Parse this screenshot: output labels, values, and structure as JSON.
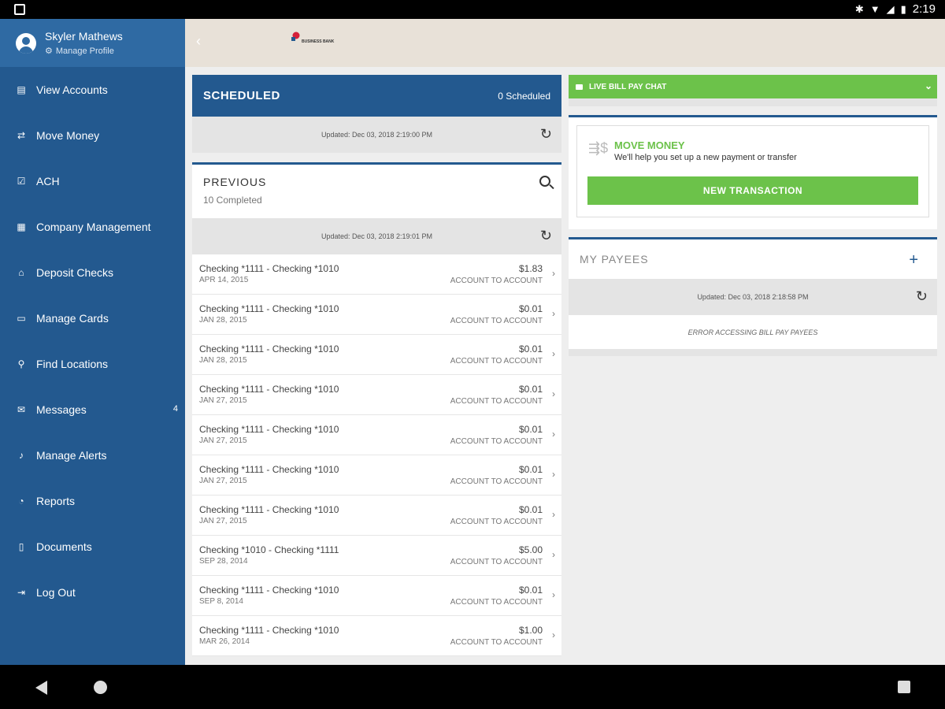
{
  "status_bar": {
    "time": "2:19"
  },
  "profile": {
    "name": "Skyler Mathews",
    "manage_label": "Manage Profile"
  },
  "sidebar": {
    "items": [
      {
        "label": "View Accounts",
        "icon": "accounts-icon",
        "glyph": "▤"
      },
      {
        "label": "Move Money",
        "icon": "transfer-icon",
        "glyph": "⇄"
      },
      {
        "label": "ACH",
        "icon": "check-icon",
        "glyph": "☑"
      },
      {
        "label": "Company Management",
        "icon": "building-icon",
        "glyph": "▦"
      },
      {
        "label": "Deposit Checks",
        "icon": "bank-icon",
        "glyph": "⌂"
      },
      {
        "label": "Manage Cards",
        "icon": "card-icon",
        "glyph": "▭"
      },
      {
        "label": "Find Locations",
        "icon": "location-pin-icon",
        "glyph": "⚲"
      },
      {
        "label": "Messages",
        "icon": "mail-icon",
        "glyph": "✉",
        "badge": "4"
      },
      {
        "label": "Manage Alerts",
        "icon": "bell-icon",
        "glyph": "♪"
      },
      {
        "label": "Reports",
        "icon": "chart-icon",
        "glyph": "◔"
      },
      {
        "label": "Documents",
        "icon": "document-icon",
        "glyph": "▯"
      },
      {
        "label": "Log Out",
        "icon": "logout-icon",
        "glyph": "⇥"
      }
    ]
  },
  "header": {
    "logo_text": "BUSINESS BANK"
  },
  "scheduled": {
    "title": "SCHEDULED",
    "count": "0 Scheduled",
    "updated": "Updated: Dec 03, 2018 2:19:00 PM"
  },
  "previous": {
    "title": "PREVIOUS",
    "subtitle": "10 Completed",
    "updated": "Updated: Dec 03, 2018 2:19:01 PM",
    "transactions": [
      {
        "name": "Checking *1111 - Checking *1010",
        "date": "APR 14, 2015",
        "amount": "$1.83",
        "type": "ACCOUNT TO ACCOUNT"
      },
      {
        "name": "Checking *1111 - Checking *1010",
        "date": "JAN 28, 2015",
        "amount": "$0.01",
        "type": "ACCOUNT TO ACCOUNT"
      },
      {
        "name": "Checking *1111 - Checking *1010",
        "date": "JAN 28, 2015",
        "amount": "$0.01",
        "type": "ACCOUNT TO ACCOUNT"
      },
      {
        "name": "Checking *1111 - Checking *1010",
        "date": "JAN 27, 2015",
        "amount": "$0.01",
        "type": "ACCOUNT TO ACCOUNT"
      },
      {
        "name": "Checking *1111 - Checking *1010",
        "date": "JAN 27, 2015",
        "amount": "$0.01",
        "type": "ACCOUNT TO ACCOUNT"
      },
      {
        "name": "Checking *1111 - Checking *1010",
        "date": "JAN 27, 2015",
        "amount": "$0.01",
        "type": "ACCOUNT TO ACCOUNT"
      },
      {
        "name": "Checking *1111 - Checking *1010",
        "date": "JAN 27, 2015",
        "amount": "$0.01",
        "type": "ACCOUNT TO ACCOUNT"
      },
      {
        "name": "Checking *1010 - Checking *1111",
        "date": "SEP 28, 2014",
        "amount": "$5.00",
        "type": "ACCOUNT TO ACCOUNT"
      },
      {
        "name": "Checking *1111 - Checking *1010",
        "date": "SEP 8, 2014",
        "amount": "$0.01",
        "type": "ACCOUNT TO ACCOUNT"
      },
      {
        "name": "Checking *1111 - Checking *1010",
        "date": "MAR 26, 2014",
        "amount": "$1.00",
        "type": "ACCOUNT TO ACCOUNT"
      }
    ]
  },
  "chat": {
    "label": "LIVE BILL PAY CHAT"
  },
  "move_money": {
    "title": "MOVE MONEY",
    "description": "We'll help you set up a new payment or transfer",
    "button": "NEW TRANSACTION"
  },
  "payees": {
    "title": "MY PAYEES",
    "updated": "Updated: Dec 03, 2018 2:18:58 PM",
    "error": "ERROR ACCESSING BILL PAY PAYEES"
  },
  "colors": {
    "primary": "#23598f",
    "accent_green": "#6cc24a",
    "topbar_bg": "#e8e1d8"
  }
}
